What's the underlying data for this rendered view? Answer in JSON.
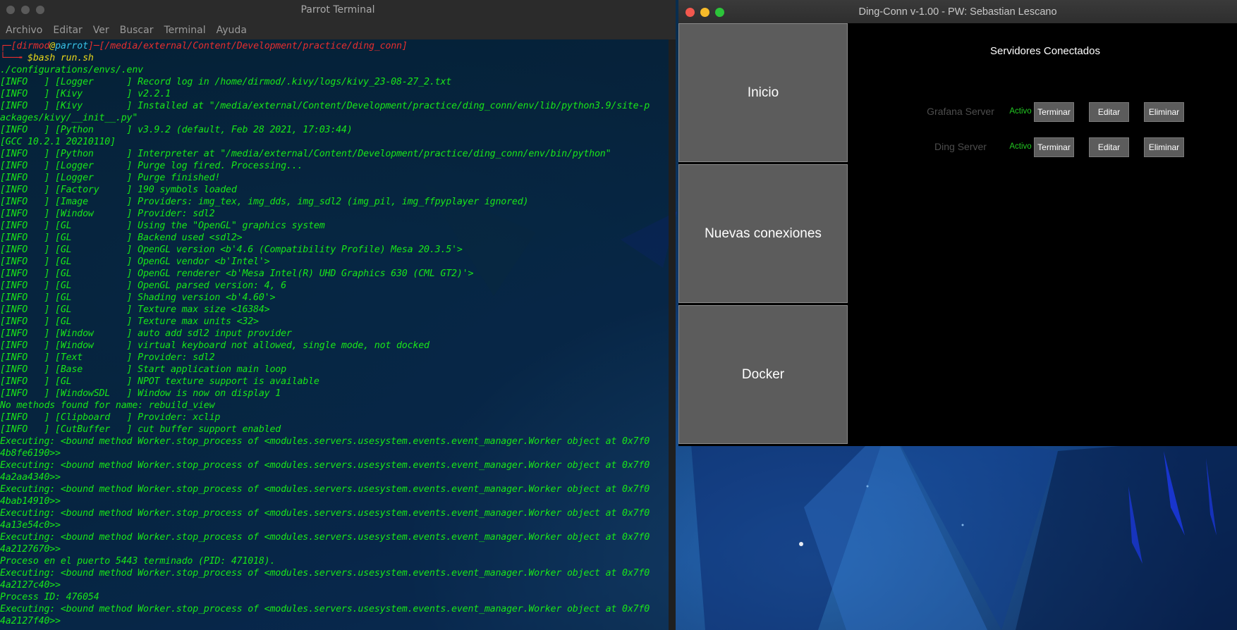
{
  "terminal": {
    "title": "Parrot Terminal",
    "menu": [
      "Archivo",
      "Editar",
      "Ver",
      "Buscar",
      "Terminal",
      "Ayuda"
    ],
    "prompt": {
      "user": "dirmod",
      "at": "@",
      "host": "parrot",
      "path": "/media/external/Content/Development/practice/ding_conn",
      "command": "$bash run.sh"
    },
    "lines": [
      "./configurations/envs/.env",
      "[INFO   ] [Logger      ] Record log in /home/dirmod/.kivy/logs/kivy_23-08-27_2.txt",
      "[INFO   ] [Kivy        ] v2.2.1",
      "[INFO   ] [Kivy        ] Installed at \"/media/external/Content/Development/practice/ding_conn/env/lib/python3.9/site-p",
      "ackages/kivy/__init__.py\"",
      "[INFO   ] [Python      ] v3.9.2 (default, Feb 28 2021, 17:03:44)",
      "[GCC 10.2.1 20210110]",
      "[INFO   ] [Python      ] Interpreter at \"/media/external/Content/Development/practice/ding_conn/env/bin/python\"",
      "[INFO   ] [Logger      ] Purge log fired. Processing...",
      "[INFO   ] [Logger      ] Purge finished!",
      "[INFO   ] [Factory     ] 190 symbols loaded",
      "[INFO   ] [Image       ] Providers: img_tex, img_dds, img_sdl2 (img_pil, img_ffpyplayer ignored)",
      "[INFO   ] [Window      ] Provider: sdl2",
      "[INFO   ] [GL          ] Using the \"OpenGL\" graphics system",
      "[INFO   ] [GL          ] Backend used <sdl2>",
      "[INFO   ] [GL          ] OpenGL version <b'4.6 (Compatibility Profile) Mesa 20.3.5'>",
      "[INFO   ] [GL          ] OpenGL vendor <b'Intel'>",
      "[INFO   ] [GL          ] OpenGL renderer <b'Mesa Intel(R) UHD Graphics 630 (CML GT2)'>",
      "[INFO   ] [GL          ] OpenGL parsed version: 4, 6",
      "[INFO   ] [GL          ] Shading version <b'4.60'>",
      "[INFO   ] [GL          ] Texture max size <16384>",
      "[INFO   ] [GL          ] Texture max units <32>",
      "[INFO   ] [Window      ] auto add sdl2 input provider",
      "[INFO   ] [Window      ] virtual keyboard not allowed, single mode, not docked",
      "[INFO   ] [Text        ] Provider: sdl2",
      "[INFO   ] [Base        ] Start application main loop",
      "[INFO   ] [GL          ] NPOT texture support is available",
      "[INFO   ] [WindowSDL   ] Window is now on display 1",
      "No methods found for name: rebuild_view",
      "[INFO   ] [Clipboard   ] Provider: xclip",
      "[INFO   ] [CutBuffer   ] cut buffer support enabled",
      "Executing: <bound method Worker.stop_process of <modules.servers.usesystem.events.event_manager.Worker object at 0x7f0",
      "4b8fe6190>>",
      "Executing: <bound method Worker.stop_process of <modules.servers.usesystem.events.event_manager.Worker object at 0x7f0",
      "4a2aa4340>>",
      "Executing: <bound method Worker.stop_process of <modules.servers.usesystem.events.event_manager.Worker object at 0x7f0",
      "4bab14910>>",
      "Executing: <bound method Worker.stop_process of <modules.servers.usesystem.events.event_manager.Worker object at 0x7f0",
      "4a13e54c0>>",
      "Executing: <bound method Worker.stop_process of <modules.servers.usesystem.events.event_manager.Worker object at 0x7f0",
      "4a2127670>>",
      "Proceso en el puerto 5443 terminado (PID: 471018).",
      "Executing: <bound method Worker.stop_process of <modules.servers.usesystem.events.event_manager.Worker object at 0x7f0",
      "4a2127c40>>",
      "Process ID: 476054",
      "Executing: <bound method Worker.stop_process of <modules.servers.usesystem.events.event_manager.Worker object at 0x7f0",
      "4a2127f40>>"
    ]
  },
  "app": {
    "title": "Ding-Conn v-1.00 - PW: Sebastian Lescano",
    "sidebar": [
      "Inicio",
      "Nuevas conexiones",
      "Docker"
    ],
    "header": "Servidores Conectados",
    "servers": [
      {
        "name": "Grafana Server",
        "status": "Activo",
        "terminate": "Terminar",
        "edit": "Editar",
        "delete": "Eliminar"
      },
      {
        "name": "Ding Server",
        "status": "Activo",
        "terminate": "Terminar",
        "edit": "Editar",
        "delete": "Eliminar"
      }
    ]
  },
  "colors": {
    "terminal_text": "#19e619",
    "prompt_red": "#e62e2e",
    "prompt_host": "#38c2e6",
    "status_active": "#22c922",
    "button_gray": "#5c5c5c"
  }
}
